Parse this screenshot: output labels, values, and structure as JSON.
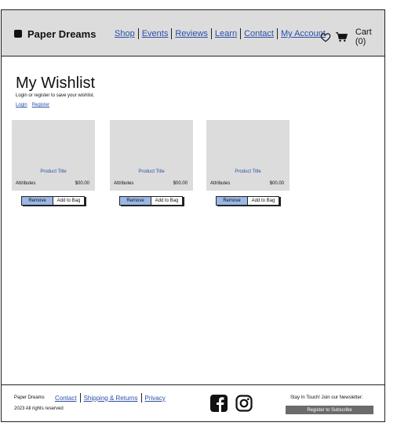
{
  "header": {
    "brand": "Paper Dreams",
    "nav": [
      "Shop",
      "Events",
      "Reviews",
      "Learn",
      "Contact",
      "My Account"
    ],
    "cart_label": "Cart (0)",
    "icons": [
      "heart-icon",
      "cart-icon"
    ]
  },
  "main": {
    "title": "My Wishlist",
    "subtext": "Login or register to save your wishlist.",
    "login_link": "Login",
    "register_link": "Register",
    "items": [
      {
        "title": "Product Title",
        "attributes": "Attributes",
        "price": "$00.00",
        "remove_label": "Remove",
        "add_label": "Add to Bag"
      },
      {
        "title": "Product Title",
        "attributes": "Attributes",
        "price": "$00.00",
        "remove_label": "Remove",
        "add_label": "Add to Bag"
      },
      {
        "title": "Product Title",
        "attributes": "Attributes",
        "price": "$00.00",
        "remove_label": "Remove",
        "add_label": "Add to Bag"
      }
    ]
  },
  "footer": {
    "brand": "Paper Dreams",
    "links": [
      "Contact",
      "Shipping & Returns",
      "Privacy"
    ],
    "copyright": "2023 All rights reserved",
    "social": [
      "facebook-icon",
      "instagram-icon"
    ],
    "newsletter_text": "Stay In Touch! Join our Newsletter:",
    "subscribe_label": "Register to Subscribe"
  },
  "colors": {
    "header_bg": "#dcdcdc",
    "link": "#2a4fa8",
    "remove_button": "#9ab7e6",
    "subscribe_button": "#6b6b6b"
  }
}
